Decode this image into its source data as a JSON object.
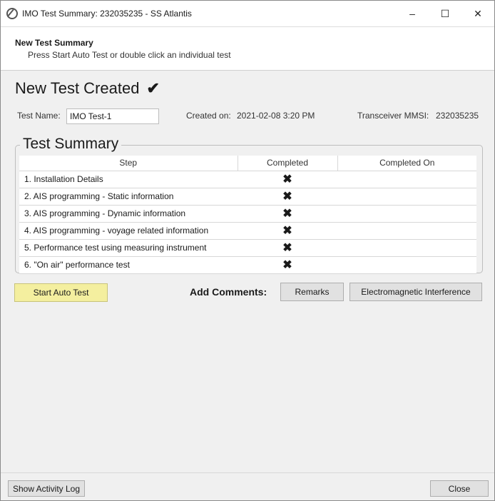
{
  "window": {
    "title": "IMO Test Summary: 232035235 - SS Atlantis",
    "minimize_icon": "–",
    "maximize_icon": "☐",
    "close_icon": "✕"
  },
  "header": {
    "title": "New Test Summary",
    "subtitle": "Press Start Auto Test or double click an individual test"
  },
  "status": {
    "title": "New Test Created",
    "icon": "✔"
  },
  "fields": {
    "test_name_label": "Test Name:",
    "test_name_value": "IMO Test-1",
    "created_on_label": "Created on:",
    "created_on_value": "2021-02-08 3:20 PM",
    "mmsi_label": "Transceiver MMSI:",
    "mmsi_value": "232035235"
  },
  "test_summary": {
    "legend": "Test Summary",
    "columns": [
      "Step",
      "Completed",
      "Completed On"
    ],
    "rows": [
      {
        "step": "1. Installation Details",
        "completed": "✖",
        "completed_on": ""
      },
      {
        "step": "2. AIS programming - Static information",
        "completed": "✖",
        "completed_on": ""
      },
      {
        "step": "3. AIS programming - Dynamic information",
        "completed": "✖",
        "completed_on": ""
      },
      {
        "step": "4. AIS programming - voyage related information",
        "completed": "✖",
        "completed_on": ""
      },
      {
        "step": "5. Performance test using measuring instrument",
        "completed": "✖",
        "completed_on": ""
      },
      {
        "step": "6. \"On air\" performance test",
        "completed": "✖",
        "completed_on": ""
      }
    ]
  },
  "actions": {
    "start_auto_test": "Start Auto Test",
    "add_comments": "Add Comments:",
    "remarks": "Remarks",
    "emi": "Electromagnetic Interference"
  },
  "footer": {
    "show_activity_log": "Show Activity Log",
    "close": "Close"
  },
  "colors": {
    "start_button": "#f4ef9f",
    "background": "#f0f0f0"
  }
}
